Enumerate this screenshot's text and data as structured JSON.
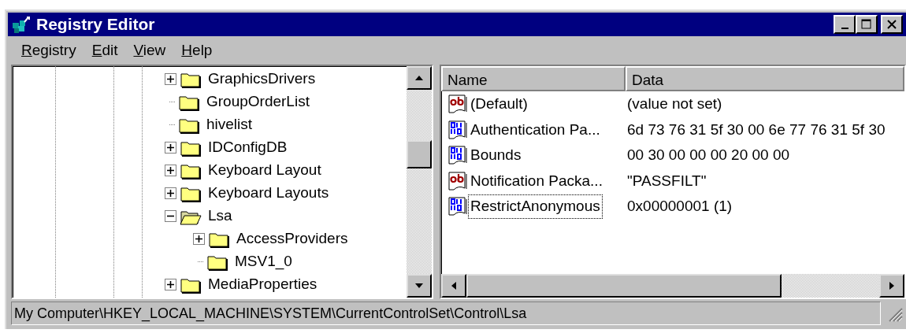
{
  "window": {
    "title": "Registry Editor"
  },
  "menu": [
    {
      "label": "Registry"
    },
    {
      "label": "Edit"
    },
    {
      "label": "View"
    },
    {
      "label": "Help"
    }
  ],
  "tree": {
    "items": [
      {
        "label": "GraphicsDrivers",
        "expanded": false,
        "selected": false
      },
      {
        "label": "GroupOrderList",
        "selected": false
      },
      {
        "label": "hivelist",
        "selected": false
      },
      {
        "label": "IDConfigDB",
        "expanded": false,
        "selected": false
      },
      {
        "label": "Keyboard Layout",
        "expanded": false,
        "selected": false
      },
      {
        "label": "Keyboard Layouts",
        "expanded": false,
        "selected": false
      },
      {
        "label": "Lsa",
        "expanded": true,
        "selected": true,
        "children": [
          {
            "label": "AccessProviders",
            "expanded": false,
            "selected": false
          },
          {
            "label": "MSV1_0",
            "selected": false
          }
        ]
      },
      {
        "label": "MediaProperties",
        "expanded": false,
        "selected": false
      }
    ]
  },
  "values": {
    "columns": [
      "Name",
      "Data"
    ],
    "rows": [
      {
        "kind": "string",
        "name": "(Default)",
        "data": "(value not set)",
        "focused": false
      },
      {
        "kind": "binary",
        "name": "Authentication Pa...",
        "data": "6d 73 76 31 5f 30 00 6e 77 76 31 5f 30",
        "focused": false
      },
      {
        "kind": "binary",
        "name": "Bounds",
        "data": "00 30 00 00 00 20 00 00",
        "focused": false
      },
      {
        "kind": "string",
        "name": "Notification Packa...",
        "data": "\"PASSFILT\"",
        "focused": false
      },
      {
        "kind": "binary",
        "name": "RestrictAnonymous",
        "data": "0x00000001 (1)",
        "focused": true
      }
    ]
  },
  "status_bar": {
    "text": "My Computer\\HKEY_LOCAL_MACHINE\\SYSTEM\\CurrentControlSet\\Control\\Lsa"
  }
}
